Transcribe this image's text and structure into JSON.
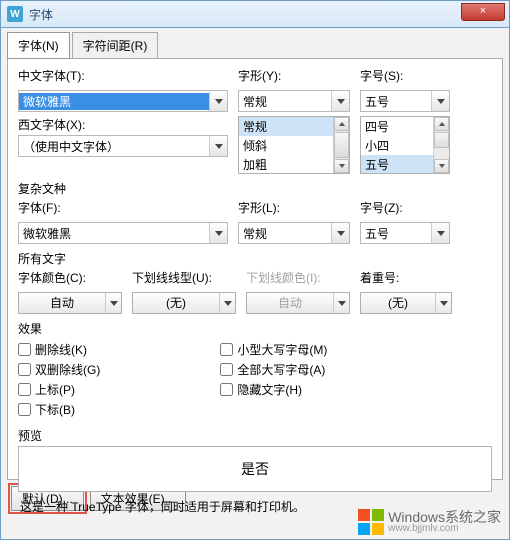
{
  "title": "字体",
  "close": "×",
  "tabs": [
    {
      "label": "字体(N)"
    },
    {
      "label": "字符间距(R)"
    }
  ],
  "groups": {
    "chinese_font_label": "中文字体(T):",
    "western_font_label": "西文字体(X):",
    "font_style_label": "字形(Y):",
    "font_size_label": "字号(S):",
    "chinese_font_value": "微软雅黑",
    "western_font_value": "（使用中文字体）",
    "font_style_value": "常规",
    "font_size_value": "五号",
    "style_options": [
      "常规",
      "倾斜",
      "加粗"
    ],
    "size_options": [
      "四号",
      "小四",
      "五号"
    ]
  },
  "complex": {
    "title": "复杂文种",
    "font_label": "字体(F):",
    "style_label": "字形(L):",
    "size_label": "字号(Z):",
    "font_value": "微软雅黑",
    "style_value": "常规",
    "size_value": "五号"
  },
  "alltext": {
    "title": "所有文字",
    "color_label": "字体颜色(C):",
    "underline_label": "下划线线型(U):",
    "underline_color_label": "下划线颜色(I):",
    "emphasis_label": "着重号:",
    "color_value": "自动",
    "underline_value": "(无)",
    "underline_color_value": "自动",
    "emphasis_value": "(无)"
  },
  "effects": {
    "title": "效果",
    "left": [
      {
        "label": "删除线(K)"
      },
      {
        "label": "双删除线(G)"
      },
      {
        "label": "上标(P)"
      },
      {
        "label": "下标(B)"
      }
    ],
    "right": [
      {
        "label": "小型大写字母(M)"
      },
      {
        "label": "全部大写字母(A)"
      },
      {
        "label": "隐藏文字(H)"
      }
    ]
  },
  "preview": {
    "title": "预览",
    "text": "是否"
  },
  "footnote": "这是一种 TrueType 字体，同时适用于屏幕和打印机。",
  "buttons": {
    "default": "默认(D)...",
    "text_effects": "文本效果(E)..."
  },
  "watermark": {
    "line1": "Windows系统之家",
    "line2": "www.bjjmlv.com"
  }
}
